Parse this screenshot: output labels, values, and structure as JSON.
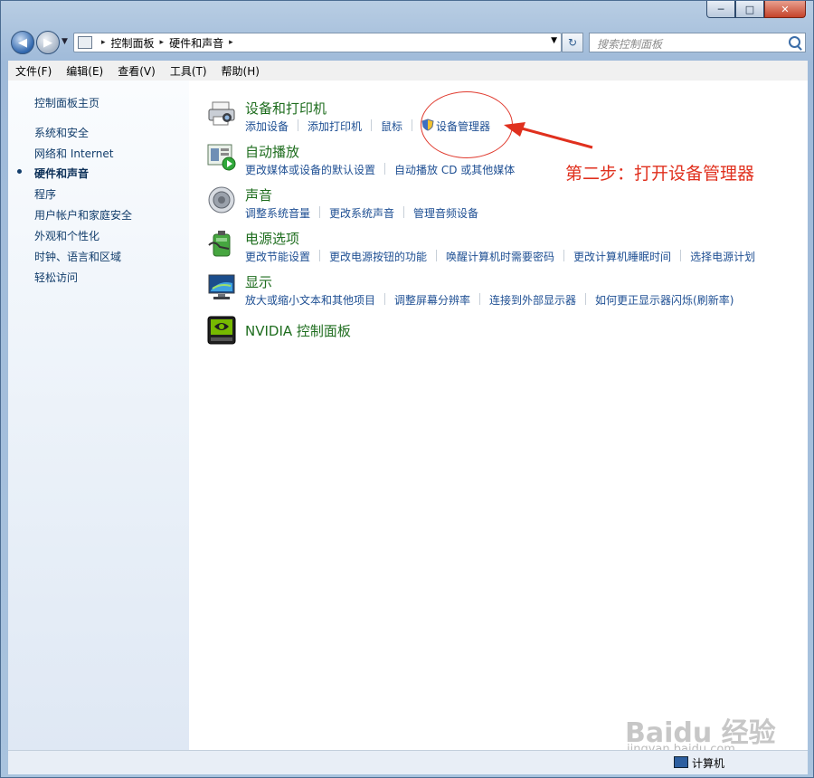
{
  "window": {
    "minimize_glyph": "─",
    "maximize_glyph": "□",
    "close_glyph": "✕"
  },
  "navigation": {
    "back_glyph": "◀",
    "forward_glyph": "▶"
  },
  "address": {
    "crumbs": [
      "控制面板",
      "硬件和声音"
    ],
    "separator": "▸",
    "dropdown_glyph": "▼",
    "refresh_glyph": "↻"
  },
  "search": {
    "placeholder": "搜索控制面板"
  },
  "menu": [
    "文件(F)",
    "编辑(E)",
    "查看(V)",
    "工具(T)",
    "帮助(H)"
  ],
  "sidebar": {
    "home": "控制面板主页",
    "items": [
      "系统和安全",
      "网络和 Internet",
      "硬件和声音",
      "程序",
      "用户帐户和家庭安全",
      "外观和个性化",
      "时钟、语言和区域",
      "轻松访问"
    ],
    "current_index": 2
  },
  "categories": [
    {
      "title": "设备和打印机",
      "icon": "printer-icon",
      "links": [
        "添加设备",
        "添加打印机",
        "鼠标",
        "设备管理器"
      ]
    },
    {
      "title": "自动播放",
      "icon": "autoplay-icon",
      "links": [
        "更改媒体或设备的默认设置",
        "自动播放 CD 或其他媒体"
      ]
    },
    {
      "title": "声音",
      "icon": "speaker-icon",
      "links": [
        "调整系统音量",
        "更改系统声音",
        "管理音频设备"
      ]
    },
    {
      "title": "电源选项",
      "icon": "battery-icon",
      "links": [
        "更改节能设置",
        "更改电源按钮的功能",
        "唤醒计算机时需要密码",
        "更改计算机睡眠时间",
        "选择电源计划"
      ]
    },
    {
      "title": "显示",
      "icon": "monitor-icon",
      "links": [
        "放大或缩小文本和其他项目",
        "调整屏幕分辨率",
        "连接到外部显示器",
        "如何更正显示器闪烁(刷新率)"
      ]
    },
    {
      "title": "NVIDIA 控制面板",
      "icon": "nvidia-icon",
      "links": []
    }
  ],
  "status": {
    "label": "计算机"
  },
  "annotation": {
    "text": "第二步：打开设备管理器",
    "color": "#e0301e"
  },
  "watermark": {
    "brand": "Baidu 经验",
    "url": "jingyan.baidu.com"
  },
  "colors": {
    "link": "#1e4f93",
    "category_title": "#1e6d1e",
    "sidebar_link": "#123d6b"
  }
}
